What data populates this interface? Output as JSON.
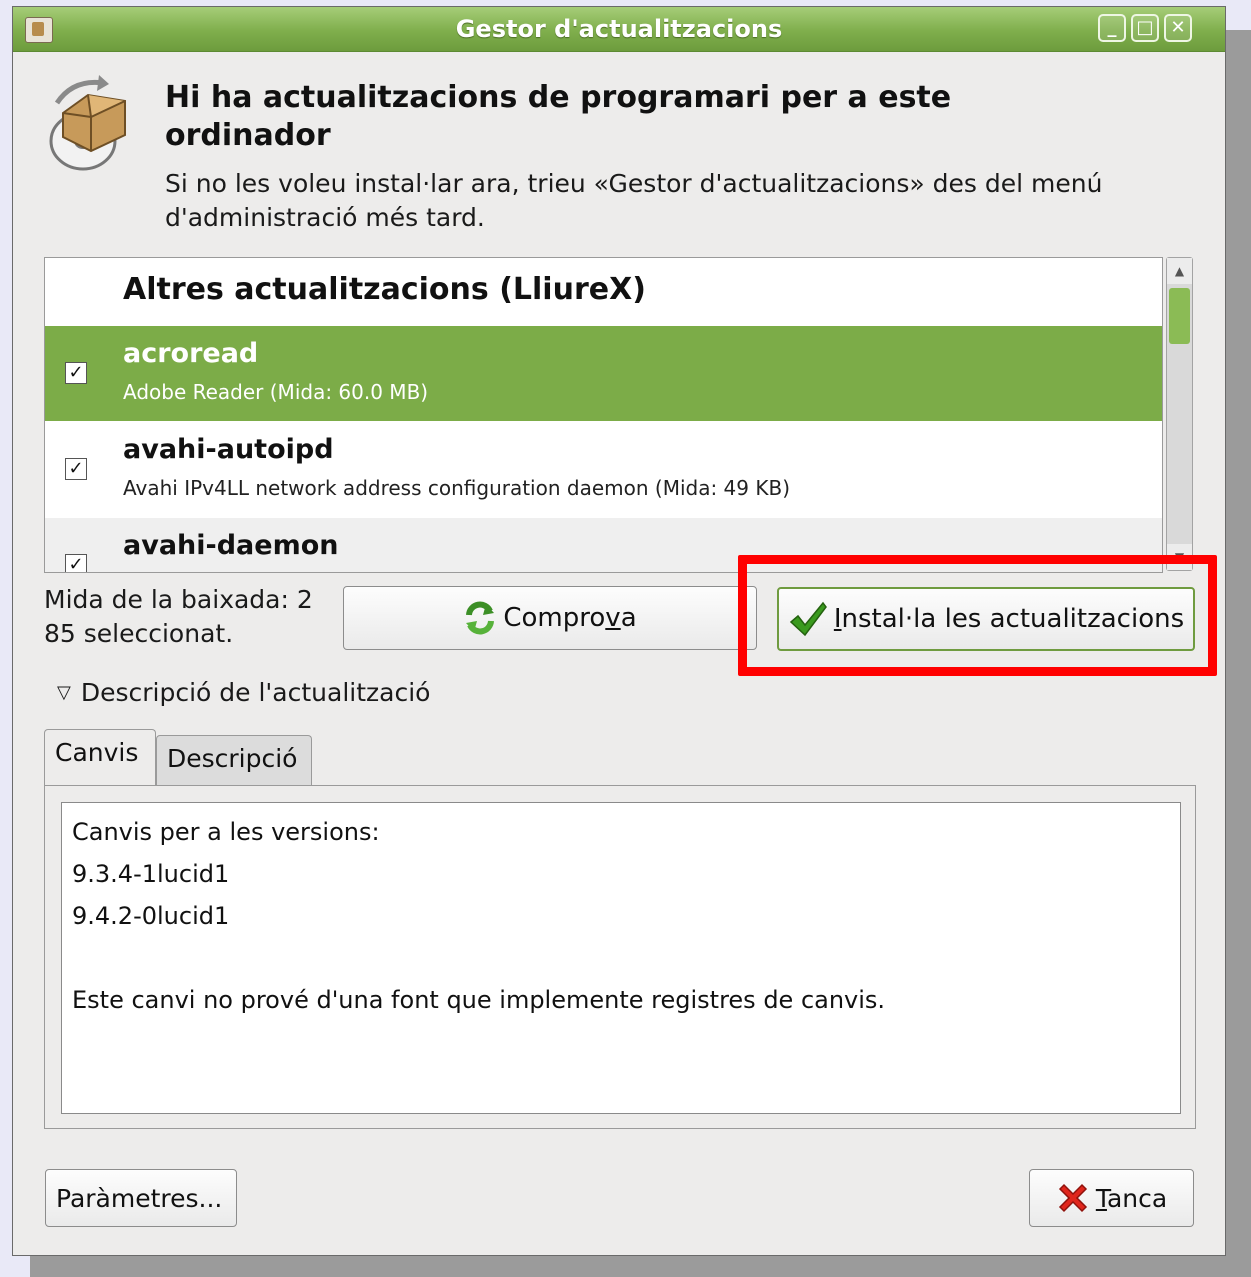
{
  "window": {
    "title": "Gestor d'actualitzacions",
    "controls": {
      "minimize": "_",
      "maximize": "□",
      "close": "✕"
    }
  },
  "header": {
    "title": "Hi ha actualitzacions de programari per a este ordinador",
    "subtitle": "Si no les voleu instal·lar ara, trieu «Gestor d'actualitzacions» des del menú d'administració més tard."
  },
  "update_list": {
    "group": "Altres actualitzacions (LliureX)",
    "items": [
      {
        "name": "acroread",
        "description": "Adobe Reader (Mida: 60.0 MB)",
        "checked": "✓",
        "selected": true
      },
      {
        "name": "avahi-autoipd",
        "description": "Avahi IPv4LL network address configuration daemon (Mida: 49 KB)",
        "checked": "✓",
        "selected": false
      },
      {
        "name": "avahi-daemon",
        "description": "",
        "checked": "✓",
        "selected": false
      }
    ]
  },
  "status": {
    "download_size": "Mida de la baixada: 2",
    "selected_count": "85 seleccionat."
  },
  "buttons": {
    "check": {
      "label_pre": "Compro",
      "label_mnemonic": "v",
      "label_post": "a",
      "icon": "refresh-icon"
    },
    "install": {
      "label_mnemonic": "I",
      "label_post": "nstal·la les actualitzacions",
      "icon": "checkmark-icon"
    },
    "settings": "Paràmetres...",
    "close": {
      "label_mnemonic": "T",
      "label_post": "anca",
      "icon": "close-x-icon"
    }
  },
  "description": {
    "expander_label": "Descripció de l'actualització",
    "tabs": [
      "Canvis",
      "Descripció"
    ],
    "active_tab": "Canvis",
    "changes": {
      "line1": "Canvis per a les versions:",
      "line2": "9.3.4-1lucid1",
      "line3": "9.4.2-0lucid1",
      "line4": "",
      "line5": "Este canvi no prové d'una font que implemente registres de canvis."
    }
  },
  "colors": {
    "accent": "#7cac48",
    "titlebar": "#86b452",
    "highlight": "#ff0000"
  }
}
